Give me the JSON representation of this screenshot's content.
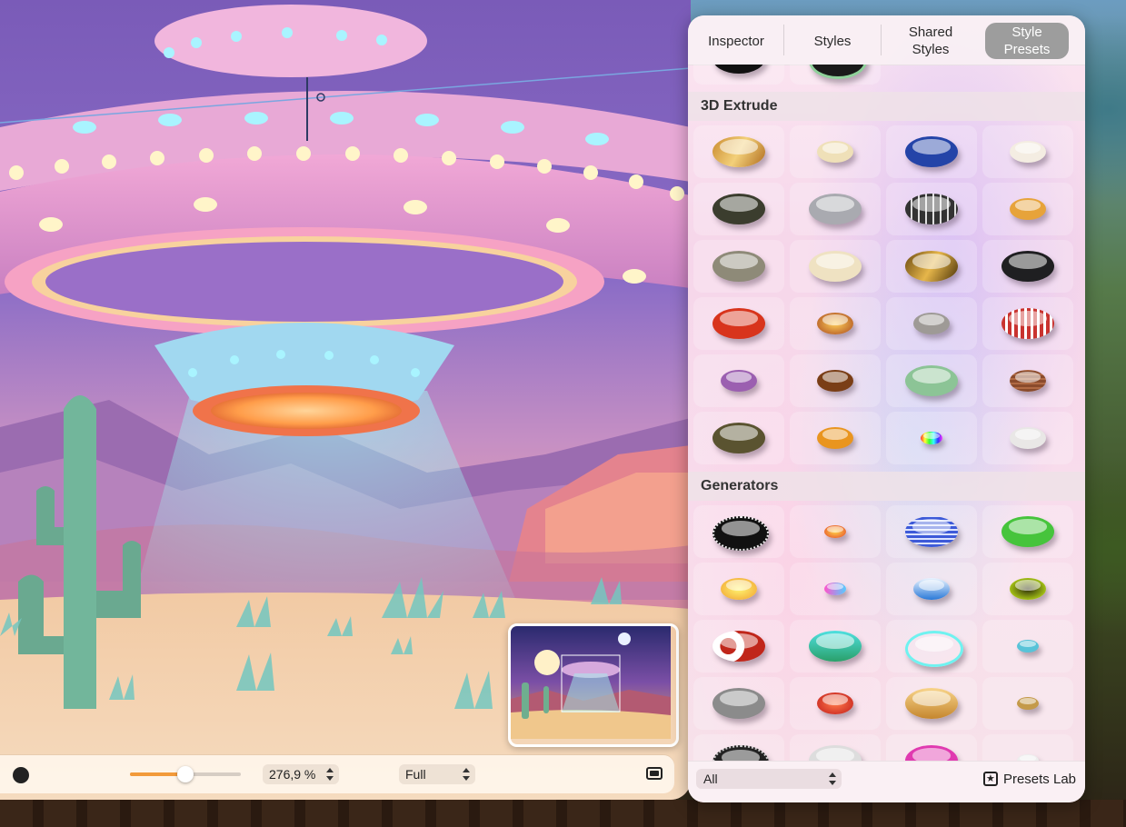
{
  "canvas": {
    "zoom_value": "276,9 %",
    "view_mode": "Full",
    "zoom_slider_fraction": 0.5
  },
  "panel": {
    "tabs": [
      {
        "label": "Inspector",
        "active": false
      },
      {
        "label": "Styles",
        "active": false
      },
      {
        "label": "Shared\nStyles",
        "active": false
      },
      {
        "label": "Style\nPresets",
        "active": true
      }
    ],
    "sections": [
      {
        "title": "3D Extrude"
      },
      {
        "title": "Generators"
      }
    ],
    "filter_value": "All",
    "lab_button": "Presets Lab"
  },
  "icons": {
    "color_dot": "color-dot-icon",
    "fit": "fit-window-icon",
    "star": "star-square-icon"
  },
  "colors": {
    "active_tab": "#9d9d9d",
    "slider_fill": "#f29a3a"
  }
}
